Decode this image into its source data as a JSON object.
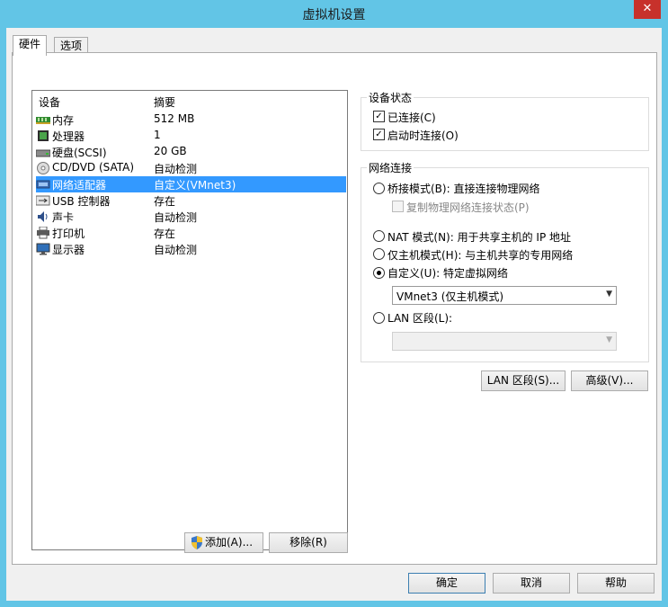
{
  "window": {
    "title": "虚拟机设置",
    "close_glyph": "✕"
  },
  "tabs": [
    {
      "label": "硬件"
    },
    {
      "label": "选项"
    }
  ],
  "device_list": {
    "header_device": "设备",
    "header_summary": "摘要",
    "rows": [
      {
        "name": "内存",
        "summary": "512 MB",
        "icon": "memory-icon"
      },
      {
        "name": "处理器",
        "summary": "1",
        "icon": "processor-icon"
      },
      {
        "name": "硬盘(SCSI)",
        "summary": "20 GB",
        "icon": "hard-disk-icon"
      },
      {
        "name": "CD/DVD (SATA)",
        "summary": "自动检测",
        "icon": "cd-dvd-icon"
      },
      {
        "name": "网络适配器",
        "summary": "自定义(VMnet3)",
        "icon": "network-adapter-icon",
        "selected": true
      },
      {
        "name": "USB 控制器",
        "summary": "存在",
        "icon": "usb-icon"
      },
      {
        "name": "声卡",
        "summary": "自动检测",
        "icon": "sound-card-icon"
      },
      {
        "name": "打印机",
        "summary": "存在",
        "icon": "printer-icon"
      },
      {
        "name": "显示器",
        "summary": "自动检测",
        "icon": "display-icon"
      }
    ]
  },
  "device_buttons": {
    "add": "添加(A)...",
    "remove": "移除(R)"
  },
  "device_status": {
    "title": "设备状态",
    "connected": "已连接(C)",
    "connect_at_power_on": "启动时连接(O)"
  },
  "network": {
    "title": "网络连接",
    "bridged": "桥接模式(B): 直接连接物理网络",
    "replicate": "复制物理网络连接状态(P)",
    "nat": "NAT 模式(N): 用于共享主机的 IP 地址",
    "host_only": "仅主机模式(H): 与主机共享的专用网络",
    "custom": "自定义(U): 特定虚拟网络",
    "custom_select": "VMnet3 (仅主机模式)",
    "lan_segment": "LAN 区段(L):",
    "lan_select": ""
  },
  "network_buttons": {
    "lan_segments": "LAN 区段(S)...",
    "advanced": "高级(V)..."
  },
  "dialog_buttons": {
    "ok": "确定",
    "cancel": "取消",
    "help": "帮助"
  },
  "colors": {
    "selection": "#3399ff",
    "titlebar": "#62c5e6",
    "close": "#c7312b"
  }
}
